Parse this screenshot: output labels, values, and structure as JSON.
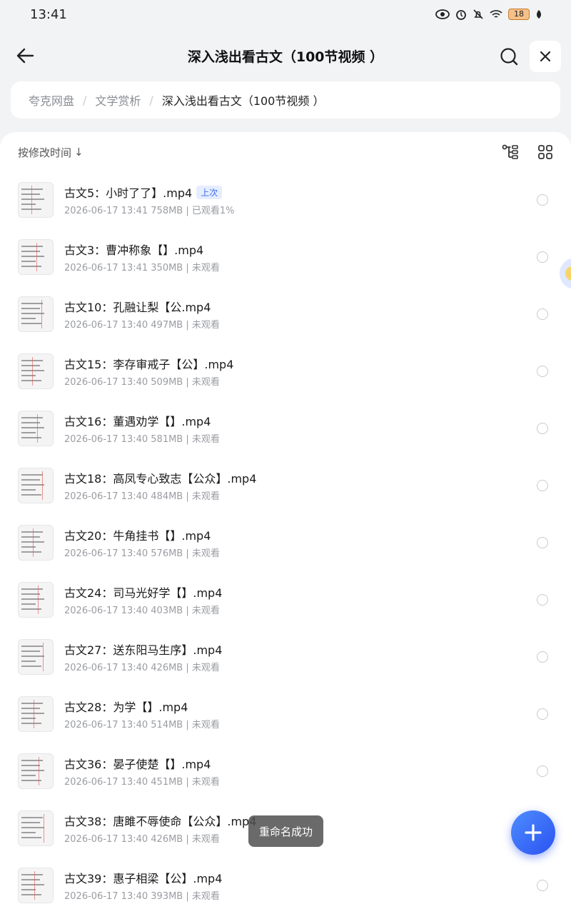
{
  "status_bar": {
    "time": "13:41",
    "battery": "18",
    "icons": [
      "eye-icon",
      "alarm-icon",
      "mute-icon",
      "wifi-icon",
      "battery-icon",
      "leaf-icon"
    ]
  },
  "header": {
    "title": "深入浅出看古文（100节视频 ）",
    "back_icon": "arrow-left-icon",
    "search_icon": "search-icon",
    "close_icon": "close-icon"
  },
  "breadcrumb": {
    "items": [
      "夸克网盘",
      "文学赏析",
      "深入浅出看古文（100节视频 ）"
    ],
    "separator": "/"
  },
  "sort": {
    "label": "按修改时间",
    "arrow": "↓"
  },
  "files": [
    {
      "name": "古文5：小时了了】.mp4",
      "badge": "上次",
      "meta": "2026-06-17 13:41  758MB | 已观看1%"
    },
    {
      "name": "古文3：曹冲称象【】.mp4",
      "badge": "",
      "meta": "2026-06-17 13:41  350MB | 未观看"
    },
    {
      "name": "古文10：孔融让梨【公.mp4",
      "badge": "",
      "meta": "2026-06-17 13:40  497MB | 未观看"
    },
    {
      "name": "古文15：李存审戒子【公】.mp4",
      "badge": "",
      "meta": "2026-06-17 13:40  509MB | 未观看"
    },
    {
      "name": "古文16：董遇劝学【】.mp4",
      "badge": "",
      "meta": "2026-06-17 13:40  581MB | 未观看"
    },
    {
      "name": "古文18：高凤专心致志【公众】.mp4",
      "badge": "",
      "meta": "2026-06-17 13:40  484MB | 未观看"
    },
    {
      "name": "古文20：牛角挂书【】.mp4",
      "badge": "",
      "meta": "2026-06-17 13:40  576MB | 未观看"
    },
    {
      "name": "古文24：司马光好学【】.mp4",
      "badge": "",
      "meta": "2026-06-17 13:40  403MB | 未观看"
    },
    {
      "name": "古文27：送东阳马生序】.mp4",
      "badge": "",
      "meta": "2026-06-17 13:40  426MB | 未观看"
    },
    {
      "name": "古文28：为学【】.mp4",
      "badge": "",
      "meta": "2026-06-17 13:40  514MB | 未观看"
    },
    {
      "name": "古文36：晏子使楚【】.mp4",
      "badge": "",
      "meta": "2026-06-17 13:40  451MB | 未观看"
    },
    {
      "name": "古文38：唐雎不辱使命【公众】.mp4",
      "badge": "",
      "meta": "2026-06-17 13:40  426MB | 未观看"
    },
    {
      "name": "古文39：惠子相梁【公】.mp4",
      "badge": "",
      "meta": "2026-06-17 13:40  393MB | 未观看"
    }
  ],
  "toast": "重命名成功",
  "fab_icon": "plus-icon",
  "colors": {
    "accent": "#3c6ef0",
    "background": "#f2f3f5"
  }
}
